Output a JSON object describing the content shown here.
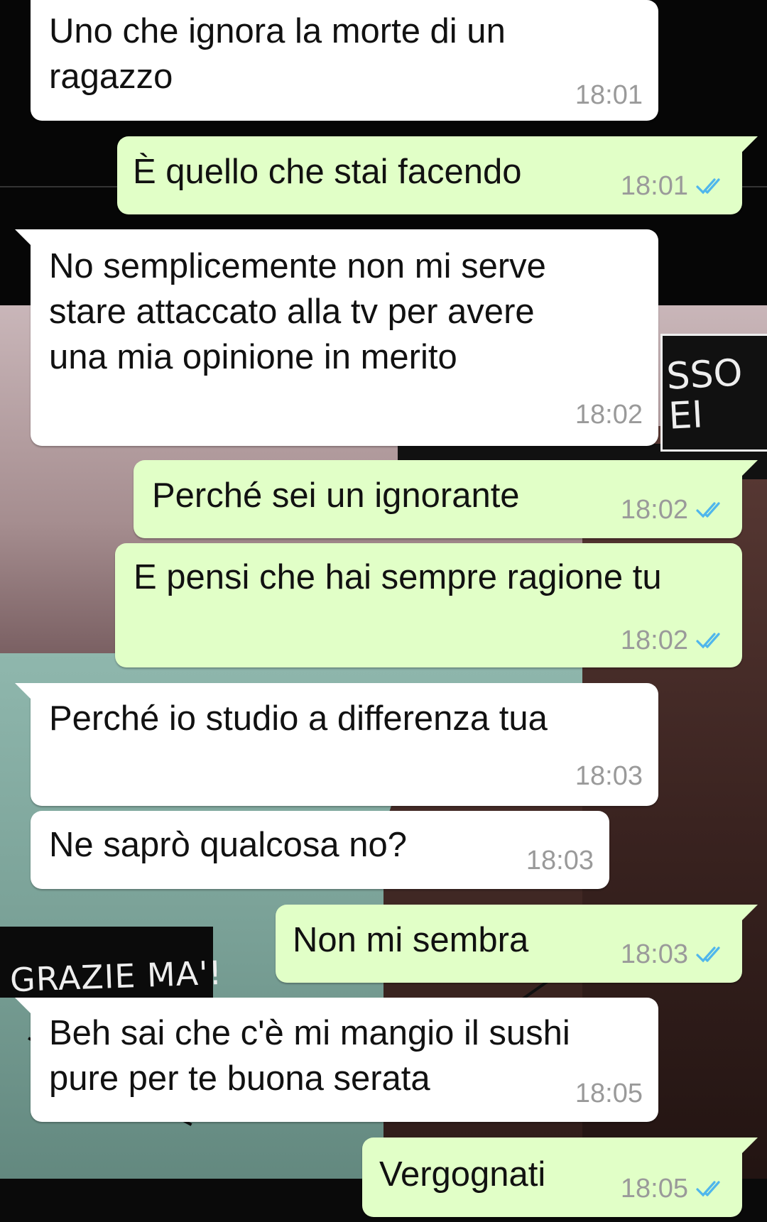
{
  "colors": {
    "incoming_bubble": "#ffffff",
    "outgoing_bubble": "#e1ffc7",
    "timestamp": "#9a9a9a",
    "read_ticks": "#4fb6ec"
  },
  "wallpaper": {
    "panel_text": "SSO\nEI",
    "sign_text": "GRAZIE MA'!"
  },
  "messages": [
    {
      "direction": "incoming",
      "text": "Uno che ignora la morte di un\nragazzo",
      "time": "18:01",
      "status_icon": "none"
    },
    {
      "direction": "outgoing",
      "text": "È quello che stai facendo",
      "time": "18:01",
      "status_icon": "double-check-read"
    },
    {
      "direction": "incoming",
      "text": "No semplicemente non mi serve\nstare attaccato alla tv per avere\nuna mia opinione in merito",
      "time": "18:02",
      "status_icon": "none"
    },
    {
      "direction": "outgoing",
      "text": "Perché sei un ignorante",
      "time": "18:02",
      "status_icon": "double-check-read"
    },
    {
      "direction": "outgoing",
      "text": "E pensi che hai sempre ragione tu",
      "time": "18:02",
      "status_icon": "double-check-read"
    },
    {
      "direction": "incoming",
      "text": "Perché io studio a differenza tua",
      "time": "18:03",
      "status_icon": "none"
    },
    {
      "direction": "incoming",
      "text": "Ne saprò qualcosa no?",
      "time": "18:03",
      "status_icon": "none"
    },
    {
      "direction": "outgoing",
      "text": "Non mi sembra",
      "time": "18:03",
      "status_icon": "double-check-read"
    },
    {
      "direction": "incoming",
      "text": "Beh sai che c'è mi mangio il sushi\npure per te buona serata",
      "time": "18:05",
      "status_icon": "none"
    },
    {
      "direction": "outgoing",
      "text": "Vergognati",
      "time": "18:05",
      "status_icon": "double-check-read"
    }
  ]
}
